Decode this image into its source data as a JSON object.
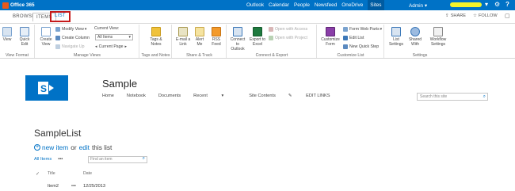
{
  "suitebar": {
    "brand": "Office 365",
    "links": [
      "Outlook",
      "Calendar",
      "People",
      "Newsfeed",
      "OneDrive",
      "Sites"
    ],
    "active_link": "Sites",
    "user": "Admin",
    "user_caret": "▾"
  },
  "ribbon_tabs": [
    "BROWSE",
    "ITEMS",
    "LIST"
  ],
  "share": {
    "share_label": "SHARE",
    "follow_label": "FOLLOW"
  },
  "ribbon": {
    "view_format": {
      "label": "View Format",
      "view": "View",
      "quick_edit": "Quick Edit"
    },
    "manage_views": {
      "label": "Manage Views",
      "create_view": "Create View",
      "modify_view": "Modify View",
      "create_column": "Create Column",
      "navigate_up": "Navigate Up",
      "current_view_label": "Current View:",
      "current_view_value": "All Items",
      "current_page": "Current Page"
    },
    "tags_notes": {
      "label": "Tags and Notes",
      "tags_notes_btn": "Tags & Notes"
    },
    "share_track": {
      "label": "Share & Track",
      "email_link": "E-mail a Link",
      "alert_me": "Alert Me",
      "rss_feed": "RSS Feed"
    },
    "connect_export": {
      "label": "Connect & Export",
      "connect_outlook": "Connect to Outlook",
      "export_excel": "Export to Excel",
      "open_access": "Open with Access",
      "open_project": "Open with Project"
    },
    "customize_list": {
      "label": "Customize List",
      "customize_form": "Customize Form",
      "form_web_parts": "Form Web Parts",
      "edit_list": "Edit List",
      "new_quick_step": "New Quick Step"
    },
    "settings": {
      "label": "Settings",
      "list_settings": "List Settings",
      "shared_with": "Shared With",
      "workflow_settings": "Workflow Settings"
    }
  },
  "site": {
    "title": "Sample",
    "nav": [
      "Home",
      "Notebook",
      "Documents",
      "Recent",
      "Site Contents"
    ],
    "recent_caret": "▾",
    "edit_links": "EDIT LINKS",
    "search_placeholder": "Search this site"
  },
  "list": {
    "title": "SampleList",
    "new_item_new": "new item",
    "new_item_or": "or",
    "new_item_edit": "edit",
    "new_item_tail": "this list",
    "view_all_items": "All Items",
    "more": "•••",
    "find_placeholder": "Find an item",
    "columns": [
      "Title",
      "Date"
    ],
    "rows": [
      {
        "title": "Item2",
        "date": "12/25/2013"
      }
    ]
  },
  "colors": {
    "suitebar": "#0072c6",
    "accent": "#0072c6",
    "highlight": "#f3f32a",
    "tab_outline": "#c61a1a"
  }
}
